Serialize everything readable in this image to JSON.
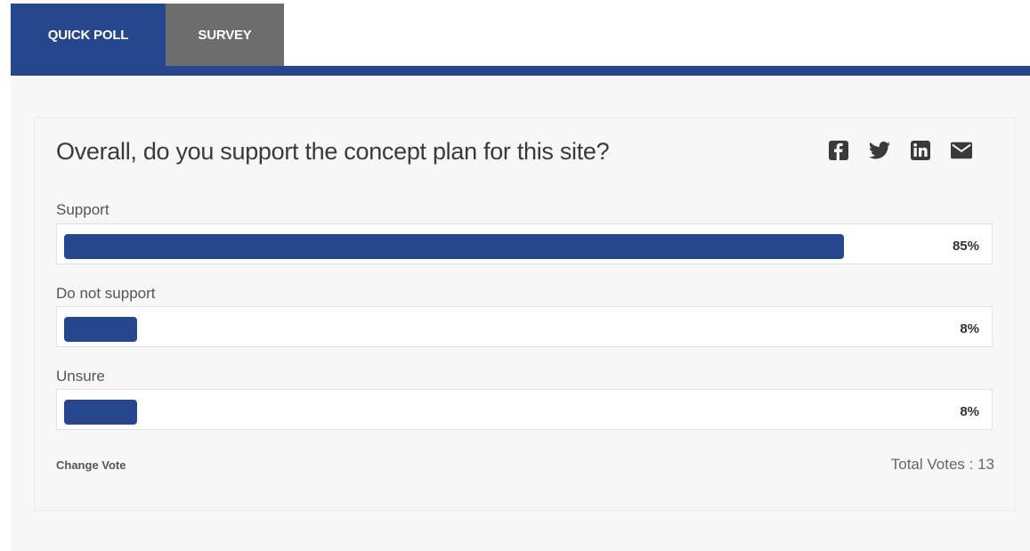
{
  "tabs": [
    {
      "label": "QUICK POLL",
      "active": true
    },
    {
      "label": "SURVEY",
      "active": false
    }
  ],
  "poll": {
    "question": "Overall, do you support the concept plan for this site?",
    "share_icons": [
      "facebook-icon",
      "twitter-icon",
      "linkedin-icon",
      "email-icon"
    ],
    "options": [
      {
        "label": "Support",
        "percent_text": "85%",
        "fraction": 0.85
      },
      {
        "label": "Do not support",
        "percent_text": "8%",
        "fraction": 0.08
      },
      {
        "label": "Unsure",
        "percent_text": "8%",
        "fraction": 0.08
      }
    ],
    "change_vote_label": "Change Vote",
    "total_votes_text": "Total Votes : 13"
  },
  "colors": {
    "accent": "#26468e",
    "inactive_tab": "#6d6d6d",
    "panel_bg": "#f7f7f7"
  }
}
